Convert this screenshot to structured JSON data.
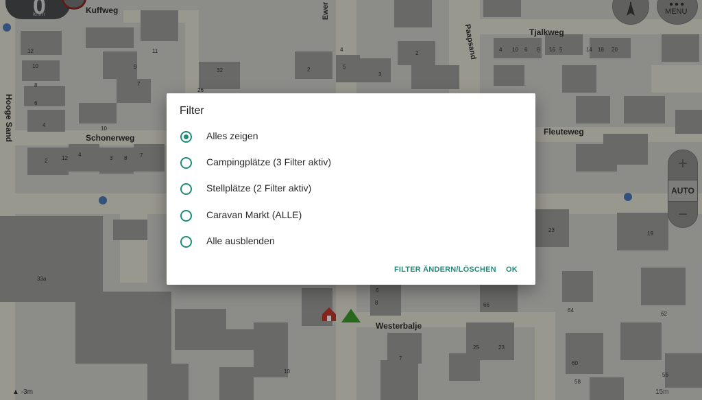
{
  "map": {
    "streets": [
      "Kuffweg",
      "Ewer",
      "Paapsand",
      "Tjalkweg",
      "Hooge Sand",
      "Schonerweg",
      "Fleuteweg",
      "Westerbalje"
    ],
    "house_numbers": [
      "12",
      "10",
      "8",
      "6",
      "4",
      "11",
      "9",
      "7",
      "5",
      "32",
      "26",
      "3",
      "2",
      "4",
      "6",
      "8",
      "10",
      "12",
      "2",
      "4",
      "5",
      "3",
      "8",
      "7",
      "2",
      "4",
      "6",
      "8",
      "10",
      "14",
      "16",
      "18",
      "20",
      "23",
      "19",
      "33a",
      "66",
      "64",
      "62",
      "25",
      "23",
      "7",
      "10",
      "60",
      "58",
      "56"
    ],
    "icons": [
      "bus-stop-icon",
      "home-icon",
      "position-arrow-icon",
      "compass-icon"
    ],
    "colors": {
      "accent": "#1f8a78",
      "vehicle": "#3b9a2b",
      "home": "#c0392b"
    }
  },
  "hud": {
    "speed_value": "0",
    "speed_unit": "km/h",
    "menu_label": "MENU",
    "zoom_plus": "+",
    "zoom_mode": "AUTO",
    "zoom_minus": "−",
    "scale_left": "-3m",
    "scale_right": "15m"
  },
  "dialog": {
    "title": "Filter",
    "options": [
      {
        "label": "Alles zeigen",
        "selected": true
      },
      {
        "label": "Campingplätze (3 Filter aktiv)",
        "selected": false
      },
      {
        "label": "Stellplätze (2 Filter aktiv)",
        "selected": false
      },
      {
        "label": "Caravan Markt (ALLE)",
        "selected": false
      },
      {
        "label": "Alle ausblenden",
        "selected": false
      }
    ],
    "edit_button": "FILTER ÄNDERN/LÖSCHEN",
    "ok_button": "OK"
  }
}
